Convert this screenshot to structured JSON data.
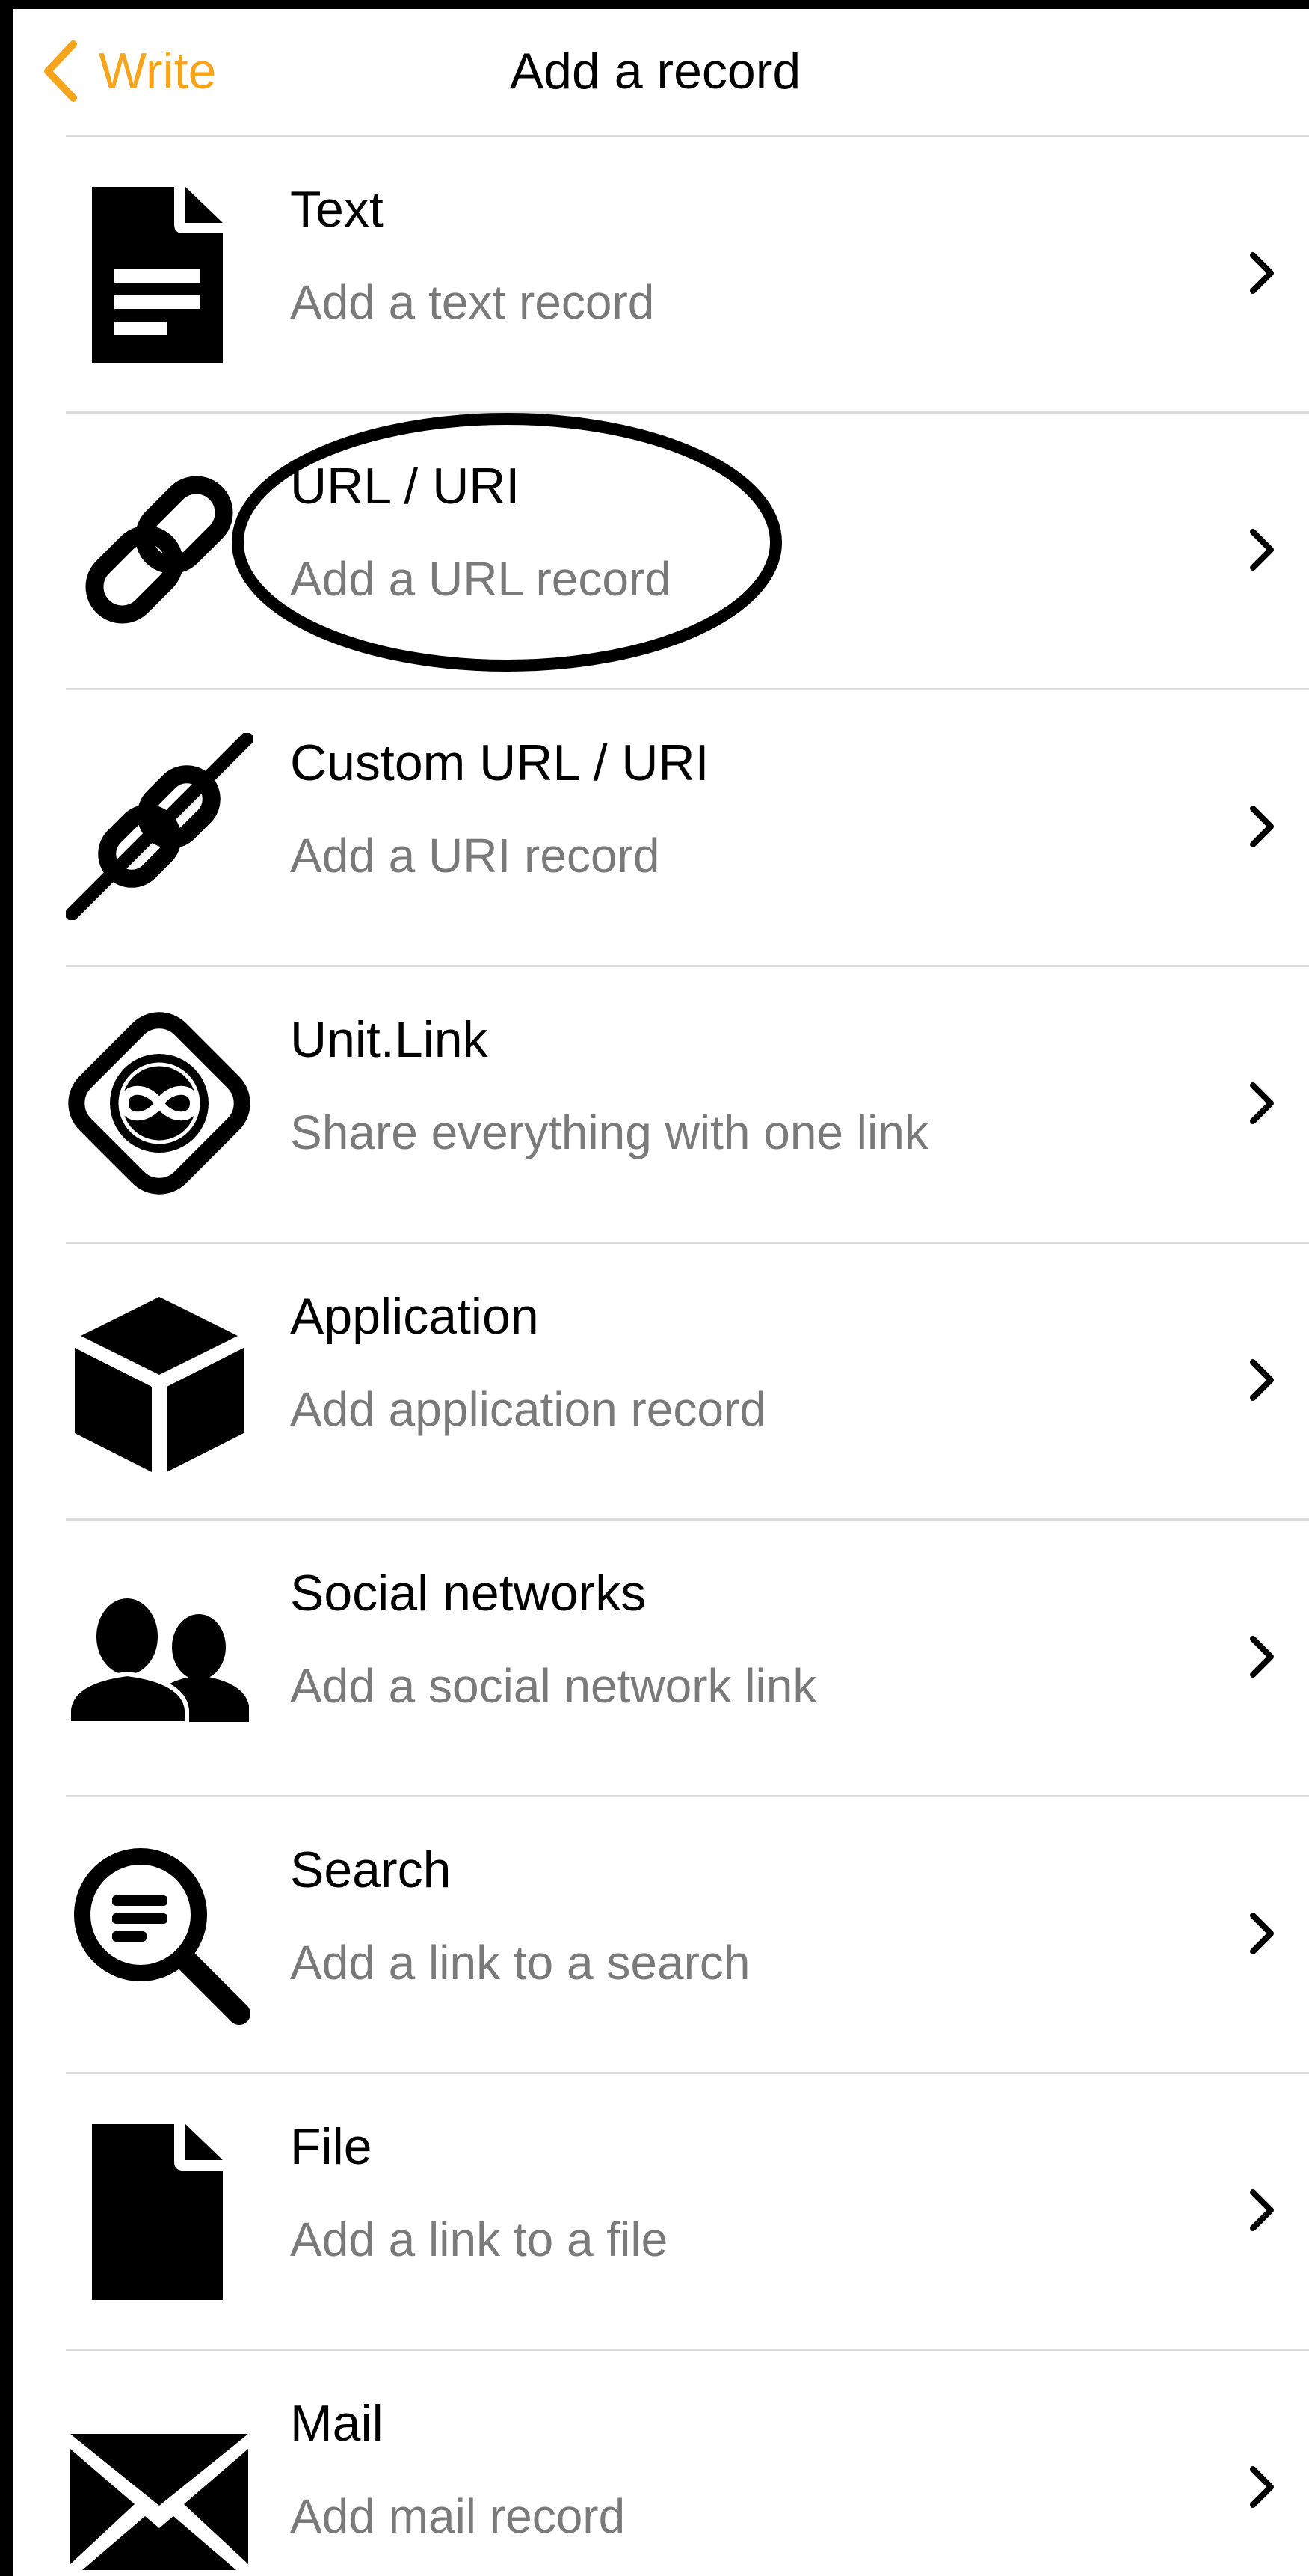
{
  "nav": {
    "back_label": "Write",
    "title": "Add a record"
  },
  "accent_color": "#f5a41b",
  "records": [
    {
      "title": "Text",
      "subtitle": "Add a text record",
      "icon": "document-text-icon"
    },
    {
      "title": "URL / URI",
      "subtitle": "Add a URL record",
      "icon": "link-icon"
    },
    {
      "title": "Custom URL / URI",
      "subtitle": "Add a URI record",
      "icon": "custom-link-icon"
    },
    {
      "title": "Unit.Link",
      "subtitle": "Share everything with one link",
      "icon": "unit-link-icon"
    },
    {
      "title": "Application",
      "subtitle": "Add application record",
      "icon": "cube-icon"
    },
    {
      "title": "Social networks",
      "subtitle": "Add a social network link",
      "icon": "people-icon"
    },
    {
      "title": "Search",
      "subtitle": "Add a link to a search",
      "icon": "search-icon"
    },
    {
      "title": "File",
      "subtitle": "Add a link to a file",
      "icon": "file-icon"
    },
    {
      "title": "Mail",
      "subtitle": "Add mail record",
      "icon": "mail-icon"
    }
  ]
}
